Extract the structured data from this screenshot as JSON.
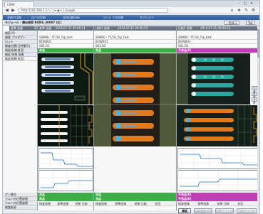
{
  "browser": {
    "tab_title": "CSRV",
    "address": "http://192.168.1.1/   ⊂ | ▾ ◀ ✕ | Google",
    "tb_right_label": "Google"
  },
  "appmenu": {
    "items": [
      "全体の比較",
      "比べの比較",
      "全体比較分析",
      "コンテ ナの比較",
      "オプション"
    ]
  },
  "pagebar": {
    "title": "モジュール - 類似検索 RQNS_30007 (比)",
    "right_select": "一覧表示",
    "right_btn": "Tab"
  },
  "labels": [
    "検索 ID",
    "検査 プロダクト",
    "ロット",
    "検査位置(日時番号)",
    "検証結果(良否)",
    "検証 結果 画像",
    "検証結果(良否)",
    "",
    "",
    "",
    "",
    "",
    "",
    "",
    "",
    "",
    "",
    "",
    "ボン番号",
    "ウエハ内位置座標",
    "ウエハ内位置座標",
    "検査画面",
    "クラス"
  ],
  "columns": [
    {
      "head": "基準 画像",
      "head_time": "2014.07.31 09:40:21",
      "cells": [
        "S0M00 - TF/16_Tsp_test",
        "BOW001",
        "001-01",
        "NG"
      ],
      "status": "良品",
      "status_color": "#3fae48",
      "bottom": [
        "良品",
        "良品"
      ],
      "footer": [
        "検査画像",
        "基準画像",
        "結果 比較",
        "良否"
      ]
    },
    {
      "head": "比較1 画像",
      "head_time": "2014.07.31 09:40:22",
      "cells": [
        "S0M00 - TF/16_Tsp_test",
        "BOW001",
        "001-02",
        "NG"
      ],
      "status": "良品",
      "status_color": "#3fae48",
      "bottom": [
        "良品",
        "良品"
      ],
      "footer": [
        "検査画像",
        "基準画像",
        "結果 比較",
        "良否"
      ]
    },
    {
      "head": "比較2 画像",
      "head_time": "2014.07.31 09:40:23",
      "cells": [
        "S0M00 - TF/16_Tsp_test",
        "BOW001",
        "001-03",
        "NG"
      ],
      "status": "不良品(E)",
      "status_color": "#c23fb1",
      "bottom": [
        "不良品(E)",
        "不良品(E)"
      ],
      "footer": [
        "検査画像",
        "基準画像",
        "結果 比較",
        "良否"
      ]
    }
  ],
  "side_buttons": [
    "比較",
    "基準",
    "全体"
  ],
  "buttons": {
    "ok": "確認",
    "b2": "比較画像の切替",
    "b3": "比較グラフの切替",
    "b4": "比較グラフの切替"
  },
  "colors": {
    "ok_green": "#3fae48",
    "ng_magenta": "#c23fb1",
    "menu_blue": "#3a67a9",
    "plot_orange": "#e89a1e",
    "plot_blue": "#2b6fbf"
  }
}
